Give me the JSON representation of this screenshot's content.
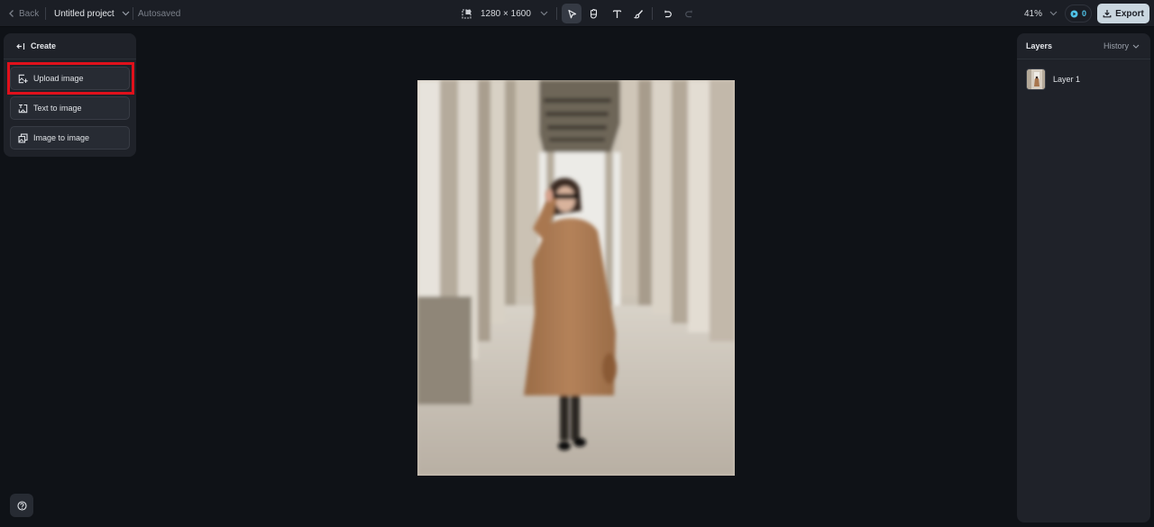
{
  "topbar": {
    "back_label": "Back",
    "project_name": "Untitled project",
    "save_status": "Autosaved",
    "canvas_size": "1280 × 1600",
    "tools": [
      {
        "name": "select-tool",
        "icon": "cursor-arrow-icon",
        "active": true
      },
      {
        "name": "hand-tool",
        "icon": "hand-icon",
        "active": false
      },
      {
        "name": "text-tool",
        "icon": "text-icon",
        "active": false
      },
      {
        "name": "brush-tool",
        "icon": "brush-icon",
        "active": false
      }
    ],
    "undo_icon": "undo-icon",
    "redo_icon": "redo-icon",
    "zoom_level": "41%",
    "credits": "0",
    "export_label": "Export"
  },
  "left_panel": {
    "title": "Create",
    "items": [
      {
        "label": "Upload image",
        "icon": "upload-image-icon",
        "highlighted": true
      },
      {
        "label": "Text to image",
        "icon": "text-to-image-icon",
        "highlighted": false
      },
      {
        "label": "Image to image",
        "icon": "image-to-image-icon",
        "highlighted": false
      }
    ],
    "highlight_color": "#e0101b"
  },
  "canvas": {
    "image_alt": "Woman in camel coat and sunglasses standing in a colonnade"
  },
  "right_panel": {
    "title": "Layers",
    "history_label": "History",
    "layers": [
      {
        "name": "Layer 1"
      }
    ]
  },
  "colors": {
    "background": "#0f1217",
    "panel": "#1f2229",
    "export_button": "#c9d6df",
    "credits_accent": "#4fc3e8"
  }
}
